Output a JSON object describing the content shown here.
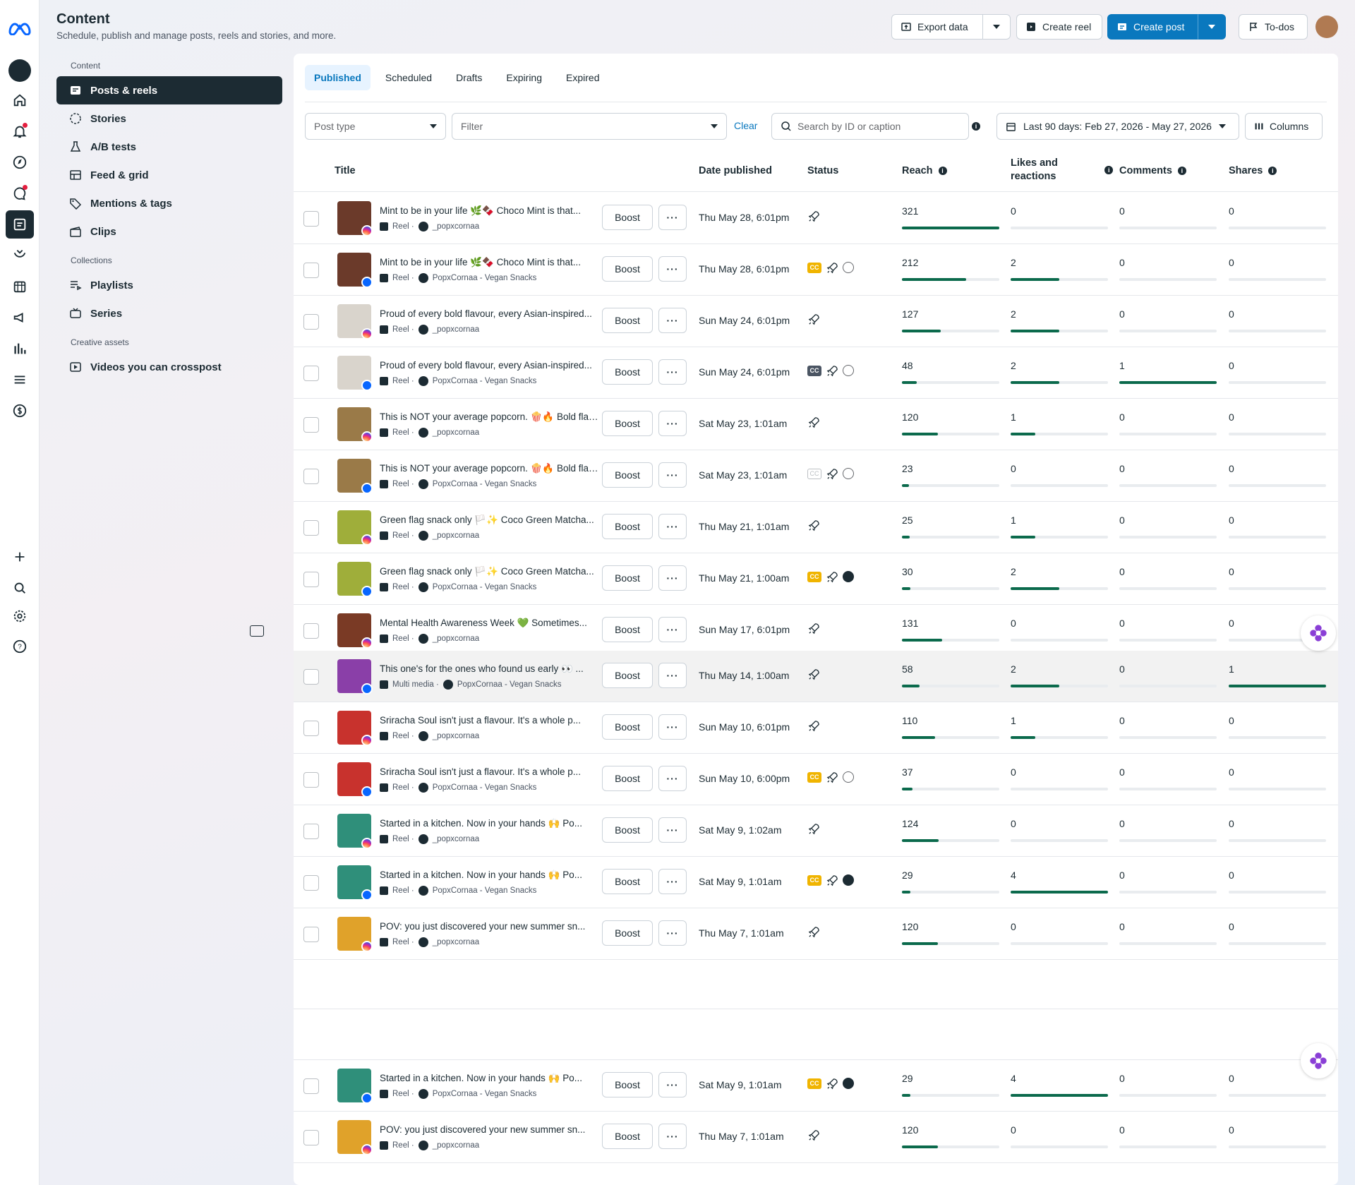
{
  "header": {
    "title": "Content",
    "subtitle": "Schedule, publish and manage posts, reels and stories, and more."
  },
  "actions": {
    "export": "Export data",
    "create_reel": "Create reel",
    "create_post": "Create post",
    "todos": "To-dos"
  },
  "sidebar": {
    "content_label": "Content",
    "items": [
      "Posts & reels",
      "Stories",
      "A/B tests",
      "Feed & grid",
      "Mentions & tags",
      "Clips"
    ],
    "collections_label": "Collections",
    "collections": [
      "Playlists",
      "Series"
    ],
    "assets_label": "Creative assets",
    "assets": [
      "Videos you can crosspost"
    ]
  },
  "tabs": [
    "Published",
    "Scheduled",
    "Drafts",
    "Expiring",
    "Expired"
  ],
  "filters": {
    "post_type": "Post type",
    "filter": "Filter",
    "clear": "Clear",
    "search_placeholder": "Search by ID or caption",
    "date_range": "Last 90 days: Feb 27, 2026 - May 27, 2026",
    "columns": "Columns"
  },
  "table": {
    "headers": {
      "title": "Title",
      "date": "Date published",
      "status": "Status",
      "reach": "Reach",
      "likes": "Likes and reactions",
      "comments": "Comments",
      "shares": "Shares"
    },
    "boost": "Boost",
    "more": "···"
  },
  "rows": [
    {
      "caption": "Mint to be in your life 🌿🍫 Choco Mint is that...",
      "type": "Reel ·",
      "account": "_popxcornaa",
      "platform": "ig",
      "date": "Thu May 28, 6:01pm",
      "status": [
        "boost"
      ],
      "reach": "321",
      "likes": "0",
      "comments": "0",
      "shares": "0",
      "reach_pct": 1,
      "likes_pct": 0,
      "comments_pct": 0,
      "shares_pct": 0,
      "thumb": "#6b3a2a"
    },
    {
      "caption": "Mint to be in your life 🌿🍫 Choco Mint is that...",
      "type": "Reel ·",
      "account": "PopxCornaa - Vegan Snacks",
      "platform": "fb",
      "date": "Thu May 28, 6:01pm",
      "status": [
        "cc",
        "boost",
        "globe"
      ],
      "reach": "212",
      "likes": "2",
      "comments": "0",
      "shares": "0",
      "reach_pct": 0.66,
      "likes_pct": 0.5,
      "comments_pct": 0,
      "shares_pct": 0,
      "thumb": "#6b3a2a"
    },
    {
      "caption": "Proud of every bold flavour, every Asian-inspired...",
      "type": "Reel ·",
      "account": "_popxcornaa",
      "platform": "ig",
      "date": "Sun May 24, 6:01pm",
      "status": [
        "boost"
      ],
      "reach": "127",
      "likes": "2",
      "comments": "0",
      "shares": "0",
      "reach_pct": 0.4,
      "likes_pct": 0.5,
      "comments_pct": 0,
      "shares_pct": 0,
      "thumb": "#d9d4cc"
    },
    {
      "caption": "Proud of every bold flavour, every Asian-inspired...",
      "type": "Reel ·",
      "account": "PopxCornaa - Vegan Snacks",
      "platform": "fb",
      "date": "Sun May 24, 6:01pm",
      "status": [
        "ccd",
        "boost",
        "globe"
      ],
      "reach": "48",
      "likes": "2",
      "comments": "1",
      "shares": "0",
      "reach_pct": 0.15,
      "likes_pct": 0.5,
      "comments_pct": 1,
      "shares_pct": 0,
      "thumb": "#d9d4cc"
    },
    {
      "caption": "This is NOT your average popcorn. 🍿🔥 Bold flavours...",
      "type": "Reel ·",
      "account": "_popxcornaa",
      "platform": "ig",
      "date": "Sat May 23, 1:01am",
      "status": [
        "boost"
      ],
      "reach": "120",
      "likes": "1",
      "comments": "0",
      "shares": "0",
      "reach_pct": 0.37,
      "likes_pct": 0.25,
      "comments_pct": 0,
      "shares_pct": 0,
      "thumb": "#9a7a48"
    },
    {
      "caption": "This is NOT your average popcorn. 🍿🔥 Bold flavours...",
      "type": "Reel ·",
      "account": "PopxCornaa - Vegan Snacks",
      "platform": "fb",
      "date": "Sat May 23, 1:01am",
      "status": [
        "ccg",
        "boost",
        "globe"
      ],
      "reach": "23",
      "likes": "0",
      "comments": "0",
      "shares": "0",
      "reach_pct": 0.07,
      "likes_pct": 0,
      "comments_pct": 0,
      "shares_pct": 0,
      "thumb": "#9a7a48"
    },
    {
      "caption": "Green flag snack only 🏳️✨ Coco Green Matcha...",
      "type": "Reel ·",
      "account": "_popxcornaa",
      "platform": "ig",
      "date": "Thu May 21, 1:01am",
      "status": [
        "boost"
      ],
      "reach": "25",
      "likes": "1",
      "comments": "0",
      "shares": "0",
      "reach_pct": 0.08,
      "likes_pct": 0.25,
      "comments_pct": 0,
      "shares_pct": 0,
      "thumb": "#9fae3a"
    },
    {
      "caption": "Green flag snack only 🏳️✨ Coco Green Matcha...",
      "type": "Reel ·",
      "account": "PopxCornaa - Vegan Snacks",
      "platform": "fb",
      "date": "Thu May 21, 1:00am",
      "status": [
        "cc",
        "boost",
        "globed"
      ],
      "reach": "30",
      "likes": "2",
      "comments": "0",
      "shares": "0",
      "reach_pct": 0.09,
      "likes_pct": 0.5,
      "comments_pct": 0,
      "shares_pct": 0,
      "thumb": "#9fae3a"
    },
    {
      "caption": "Mental Health Awareness Week 💚 Sometimes...",
      "type": "Reel ·",
      "account": "_popxcornaa",
      "platform": "ig",
      "date": "Sun May 17, 6:01pm",
      "status": [
        "boost"
      ],
      "reach": "131",
      "likes": "0",
      "comments": "0",
      "shares": "0",
      "reach_pct": 0.41,
      "likes_pct": 0,
      "comments_pct": 0,
      "shares_pct": 0,
      "thumb": "#7a3a25"
    },
    {
      "caption": "This one's for the ones who found us early 👀 ...",
      "type": "Multi media ·",
      "account": "PopxCornaa - Vegan Snacks",
      "platform": "fb",
      "date": "Thu May 14, 1:00am",
      "status": [
        "boost"
      ],
      "reach": "58",
      "likes": "2",
      "comments": "0",
      "shares": "1",
      "reach_pct": 0.18,
      "likes_pct": 0.5,
      "comments_pct": 0,
      "shares_pct": 1,
      "thumb": "#8a3fa8",
      "highlight": true
    },
    {
      "caption": "Sriracha Soul isn't just a flavour. It's a whole p...",
      "type": "Reel ·",
      "account": "_popxcornaa",
      "platform": "ig",
      "date": "Sun May 10, 6:01pm",
      "status": [
        "boost"
      ],
      "reach": "110",
      "likes": "1",
      "comments": "0",
      "shares": "0",
      "reach_pct": 0.34,
      "likes_pct": 0.25,
      "comments_pct": 0,
      "shares_pct": 0,
      "thumb": "#c8322d"
    },
    {
      "caption": "Sriracha Soul isn't just a flavour. It's a whole p...",
      "type": "Reel ·",
      "account": "PopxCornaa - Vegan Snacks",
      "platform": "fb",
      "date": "Sun May 10, 6:00pm",
      "status": [
        "cc",
        "boost",
        "globe"
      ],
      "reach": "37",
      "likes": "0",
      "comments": "0",
      "shares": "0",
      "reach_pct": 0.11,
      "likes_pct": 0,
      "comments_pct": 0,
      "shares_pct": 0,
      "thumb": "#c8322d"
    },
    {
      "caption": "Started in a kitchen. Now in your hands 🙌 Po...",
      "type": "Reel ·",
      "account": "_popxcornaa",
      "platform": "ig",
      "date": "Sat May 9, 1:02am",
      "status": [
        "boost"
      ],
      "reach": "124",
      "likes": "0",
      "comments": "0",
      "shares": "0",
      "reach_pct": 0.38,
      "likes_pct": 0,
      "comments_pct": 0,
      "shares_pct": 0,
      "thumb": "#2f8f7a"
    },
    {
      "caption": "Started in a kitchen. Now in your hands 🙌 Po...",
      "type": "Reel ·",
      "account": "PopxCornaa - Vegan Snacks",
      "platform": "fb",
      "date": "Sat May 9, 1:01am",
      "status": [
        "cc",
        "boost",
        "globed"
      ],
      "reach": "29",
      "likes": "4",
      "comments": "0",
      "shares": "0",
      "reach_pct": 0.09,
      "likes_pct": 1,
      "comments_pct": 0,
      "shares_pct": 0,
      "thumb": "#2f8f7a"
    },
    {
      "caption": "POV: you just discovered your new summer sn...",
      "type": "Reel ·",
      "account": "_popxcornaa",
      "platform": "ig",
      "date": "Thu May 7, 1:01am",
      "status": [
        "boost"
      ],
      "reach": "120",
      "likes": "0",
      "comments": "0",
      "shares": "0",
      "reach_pct": 0.37,
      "likes_pct": 0,
      "comments_pct": 0,
      "shares_pct": 0,
      "thumb": "#e0a22a"
    }
  ],
  "rows_bottom": [
    {
      "caption": "Started in a kitchen. Now in your hands 🙌 Po...",
      "type": "Reel ·",
      "account": "PopxCornaa - Vegan Snacks",
      "platform": "fb",
      "date": "Sat May 9, 1:01am",
      "status": [
        "cc",
        "boost",
        "globed"
      ],
      "reach": "29",
      "likes": "4",
      "comments": "0",
      "shares": "0",
      "reach_pct": 0.09,
      "likes_pct": 1,
      "comments_pct": 0,
      "shares_pct": 0,
      "thumb": "#2f8f7a"
    },
    {
      "caption": "POV: you just discovered your new summer sn...",
      "type": "Reel ·",
      "account": "_popxcornaa",
      "platform": "ig",
      "date": "Thu May 7, 1:01am",
      "status": [
        "boost"
      ],
      "reach": "120",
      "likes": "0",
      "comments": "0",
      "shares": "0",
      "reach_pct": 0.37,
      "likes_pct": 0,
      "comments_pct": 0,
      "shares_pct": 0,
      "thumb": "#e0a22a"
    }
  ],
  "colors": {
    "accent": "#0a78be",
    "bar": "#0b6a4c",
    "active_nav": "#1c2b33"
  }
}
